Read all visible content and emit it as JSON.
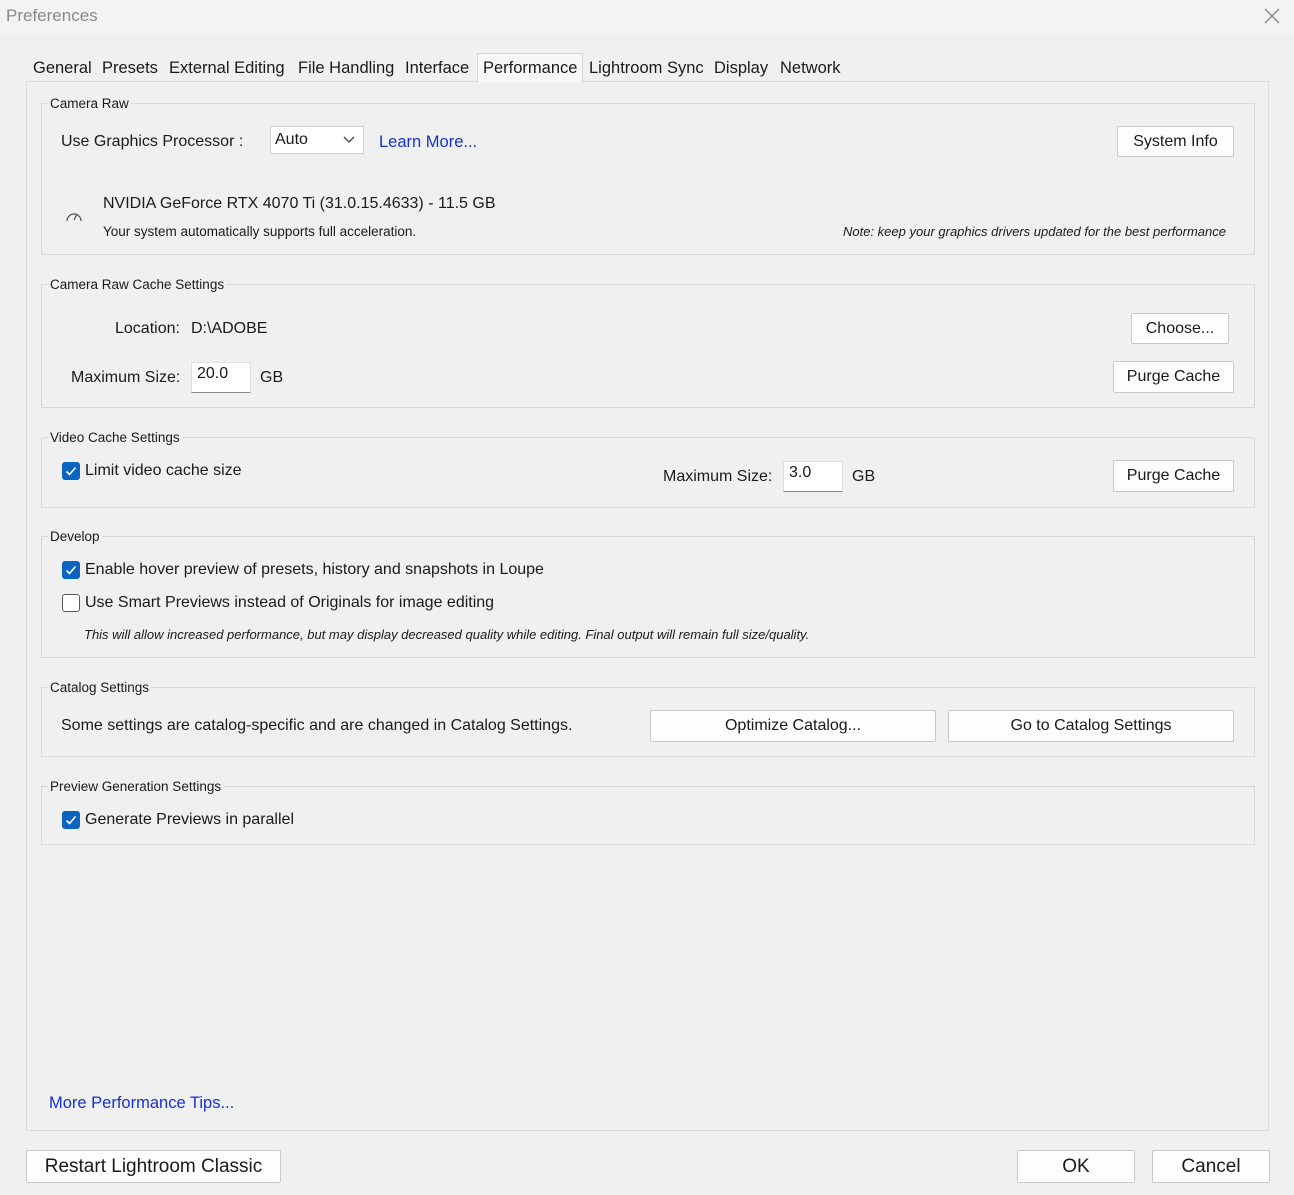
{
  "window": {
    "title": "Preferences"
  },
  "tabs": [
    {
      "label": "General"
    },
    {
      "label": "Presets"
    },
    {
      "label": "External Editing"
    },
    {
      "label": "File Handling"
    },
    {
      "label": "Interface"
    },
    {
      "label": "Performance"
    },
    {
      "label": "Lightroom Sync"
    },
    {
      "label": "Display"
    },
    {
      "label": "Network"
    }
  ],
  "camera_raw": {
    "group_label": "Camera Raw",
    "gpu_label": "Use Graphics Processor :",
    "gpu_value": "Auto",
    "learn_more": "Learn More...",
    "system_info": "System Info",
    "gpu_name": "NVIDIA GeForce RTX 4070 Ti (31.0.15.4633) - 11.5 GB",
    "gpu_status": "Your system automatically supports full acceleration.",
    "note": "Note: keep your graphics drivers updated for the best performance"
  },
  "cache": {
    "group_label": "Camera Raw Cache Settings",
    "location_label": "Location:",
    "location_value": "D:\\ADOBE",
    "choose": "Choose...",
    "max_label": "Maximum Size:",
    "max_value": "20.0",
    "unit": "GB",
    "purge": "Purge Cache"
  },
  "video": {
    "group_label": "Video Cache Settings",
    "limit_label": "Limit video cache size",
    "max_label": "Maximum Size:",
    "max_value": "3.0",
    "unit": "GB",
    "purge": "Purge Cache"
  },
  "develop": {
    "group_label": "Develop",
    "hover_label": "Enable hover preview of presets, history and snapshots in Loupe",
    "smart_label": "Use Smart Previews instead of Originals for image editing",
    "smart_note": "This will allow increased performance, but may display decreased quality while editing. Final output will remain full size/quality."
  },
  "catalog": {
    "group_label": "Catalog Settings",
    "text": "Some settings are catalog-specific and are changed in Catalog Settings.",
    "optimize": "Optimize Catalog...",
    "goto": "Go to Catalog Settings"
  },
  "preview": {
    "group_label": "Preview Generation Settings",
    "parallel_label": "Generate Previews in parallel"
  },
  "tips_link": "More Performance Tips...",
  "footer": {
    "restart": "Restart Lightroom Classic",
    "ok": "OK",
    "cancel": "Cancel"
  },
  "colors": {
    "accent": "#0a64c2",
    "link": "#1530d6"
  }
}
